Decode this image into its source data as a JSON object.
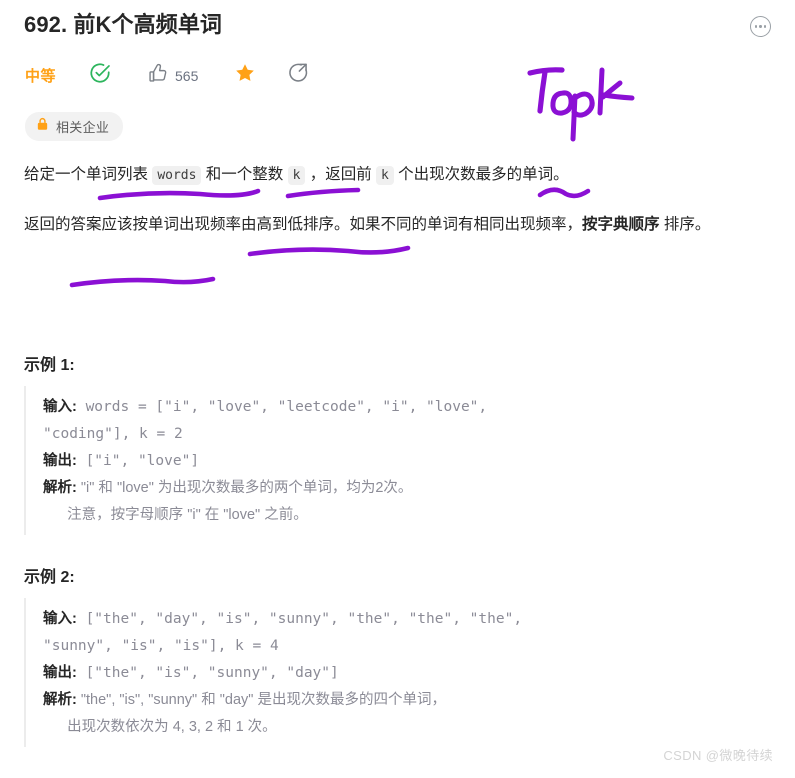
{
  "header": {
    "title": "692. 前K个高频单词",
    "more_icon": "more-horizontal-icon"
  },
  "meta": {
    "difficulty": "中等",
    "solved_icon": "check-circle-icon",
    "like_icon": "thumbs-up-icon",
    "like_count": "565",
    "favorite_icon": "star-icon",
    "share_icon": "share-icon"
  },
  "company_badge": {
    "lock_icon": "lock-icon",
    "label": "相关企业"
  },
  "annotation": {
    "handwritten_text": "Top K",
    "ink_color": "#8b10d4"
  },
  "description": {
    "paragraph1": {
      "part1": "给定一个单词列表 ",
      "code1": "words",
      "part2": " 和一个整数 ",
      "code2": "k",
      "part3": " ，返回前 ",
      "code3": "k",
      "part4": " 个出现次数最多的单词。"
    },
    "paragraph2": {
      "part1": "返回的答案应该按单词出现频率由高到低排序。如果不同的单词有相同出现频率，",
      "bold": "按字典顺序",
      "part2": " 排序。"
    }
  },
  "examples": [
    {
      "heading": "示例 1:",
      "input_label": "输入:",
      "input_value": " words = [\"i\", \"love\", \"leetcode\", \"i\", \"love\",\n\"coding\"], k = 2",
      "output_label": "输出:",
      "output_value": " [\"i\", \"love\"]",
      "explain_label": "解析:",
      "explain_value": " \"i\" 和 \"love\" 为出现次数最多的两个单词，均为2次。\n      注意，按字母顺序 \"i\" 在 \"love\" 之前。"
    },
    {
      "heading": "示例 2:",
      "input_label": "输入:",
      "input_value": " [\"the\", \"day\", \"is\", \"sunny\", \"the\", \"the\", \"the\",\n\"sunny\", \"is\", \"is\"], k = 4",
      "output_label": "输出:",
      "output_value": " [\"the\", \"is\", \"sunny\", \"day\"]",
      "explain_label": "解析:",
      "explain_value": " \"the\", \"is\", \"sunny\" 和 \"day\" 是出现次数最多的四个单词，\n      出现次数依次为 4, 3, 2 和 1 次。"
    }
  ],
  "watermark": {
    "text": "CSDN @微晚待续"
  },
  "colors": {
    "difficulty_orange": "#ffa116",
    "success_green": "#2db55d",
    "star_orange": "#ffa116",
    "ink_purple": "#8b10d4",
    "text_dark": "#262626",
    "code_gray": "#8b8b96"
  }
}
